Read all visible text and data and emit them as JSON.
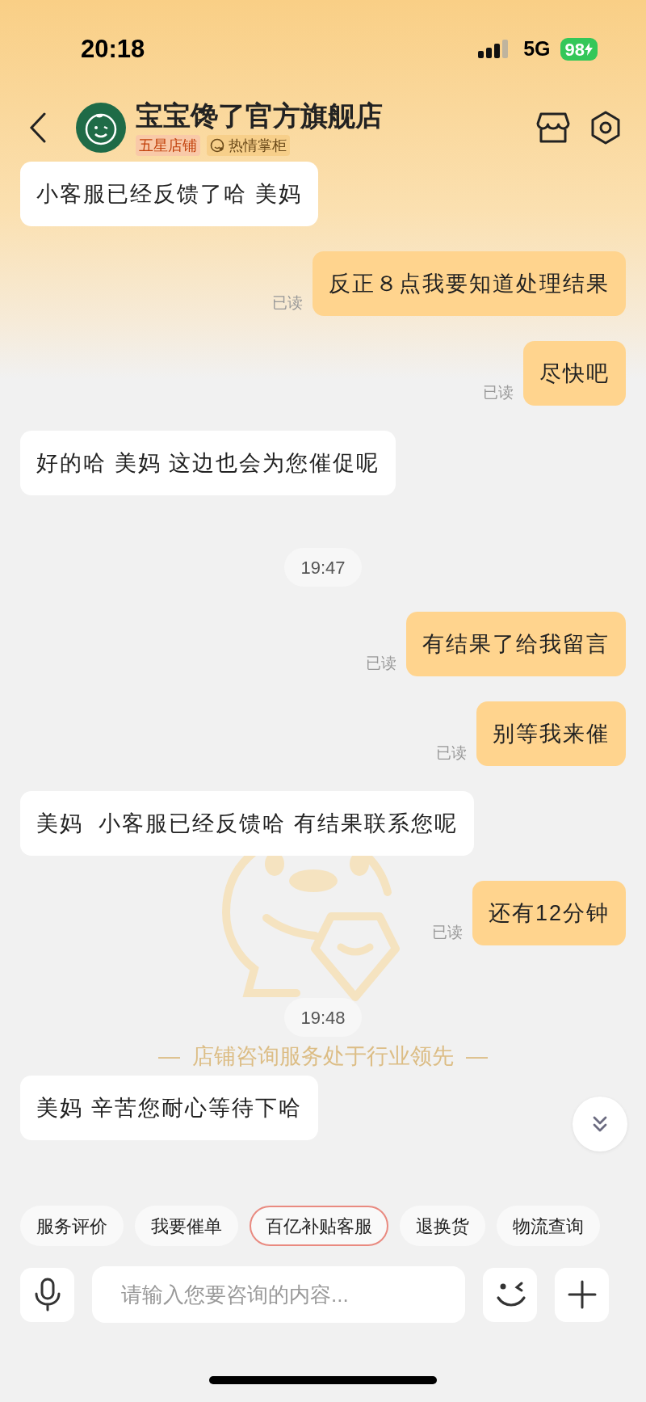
{
  "status_bar": {
    "time": "20:18",
    "network": "5G",
    "battery": "98"
  },
  "header": {
    "title": "宝宝馋了官方旗舰店",
    "badges": [
      {
        "label": "五星店铺",
        "kind": "rank"
      },
      {
        "label": "热情掌柜",
        "kind": "service"
      }
    ]
  },
  "messages": [
    {
      "kind": "incoming",
      "text": "小客服已经反馈了哈 美妈"
    },
    {
      "kind": "outgoing",
      "text": "反正８点我要知道处理结果",
      "status": "已读"
    },
    {
      "kind": "outgoing",
      "text": "尽快吧",
      "status": "已读"
    },
    {
      "kind": "incoming",
      "text": "好的哈 美妈 这边也会为您催促呢"
    },
    {
      "kind": "time",
      "text": "19:47"
    },
    {
      "kind": "outgoing",
      "text": "有结果了给我留言",
      "status": "已读"
    },
    {
      "kind": "outgoing",
      "text": "别等我来催",
      "status": "已读"
    },
    {
      "kind": "incoming",
      "text": "美妈  小客服已经反馈哈 有结果联系您呢"
    },
    {
      "kind": "outgoing",
      "text": "还有12分钟",
      "status": "已读"
    },
    {
      "kind": "time",
      "text": "19:48"
    },
    {
      "kind": "incoming",
      "text": "美妈 辛苦您耐心等待下哈"
    }
  ],
  "watermark_text": "—  店铺咨询服务处于行业领先  —",
  "quick_replies": [
    {
      "label": "服务评价",
      "highlighted": false
    },
    {
      "label": "我要催单",
      "highlighted": false
    },
    {
      "label": "百亿补贴客服",
      "highlighted": true
    },
    {
      "label": "退换货",
      "highlighted": false
    },
    {
      "label": "物流查询",
      "highlighted": false
    }
  ],
  "input": {
    "placeholder": "请输入您要咨询的内容..."
  }
}
